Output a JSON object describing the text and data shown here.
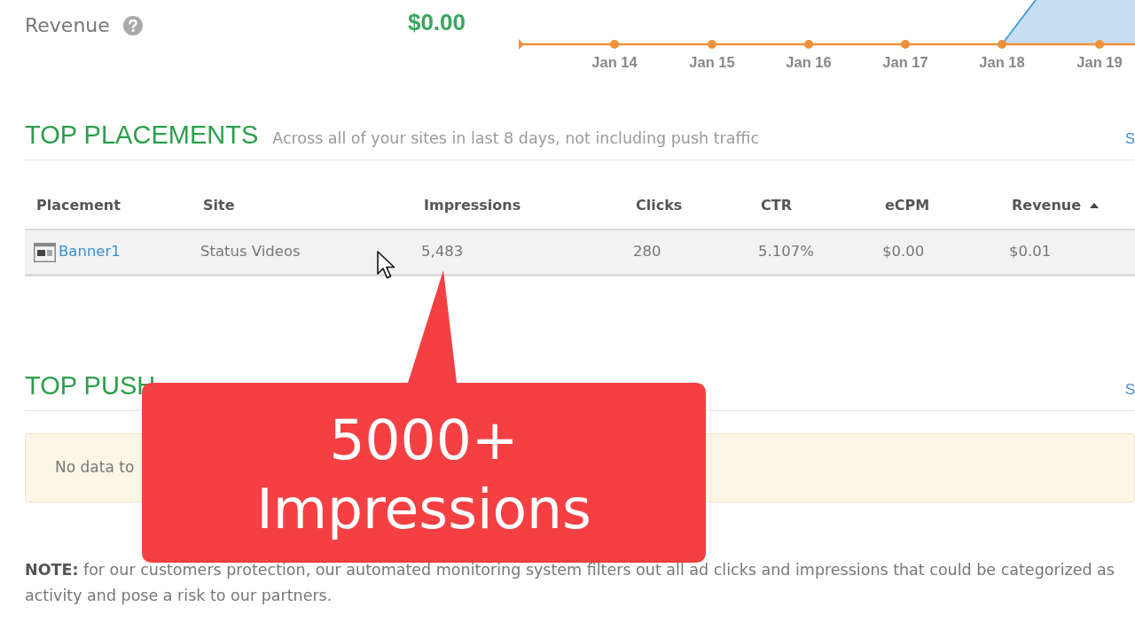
{
  "revenue": {
    "label": "Revenue",
    "value": "$0.00"
  },
  "chart": {
    "x_labels": [
      "Jan 14",
      "Jan 15",
      "Jan 16",
      "Jan 17",
      "Jan 18",
      "Jan 19"
    ]
  },
  "top_placements": {
    "title": "TOP PLACEMENTS",
    "subtitle": "Across all of your sites in last 8 days, not including push traffic",
    "link": "S",
    "columns": [
      {
        "label": "Placement",
        "kind": "placement",
        "sorted": false
      },
      {
        "label": "Site",
        "kind": "text",
        "sorted": false
      },
      {
        "label": "Impressions",
        "kind": "text",
        "sorted": false
      },
      {
        "label": "Clicks",
        "kind": "text",
        "sorted": false
      },
      {
        "label": "CTR",
        "kind": "text",
        "sorted": false
      },
      {
        "label": "eCPM",
        "kind": "text",
        "sorted": false
      },
      {
        "label": "Revenue",
        "kind": "text",
        "sorted": true
      }
    ],
    "rows": [
      {
        "cells": [
          "Banner1",
          "Status Videos",
          "5,483",
          "280",
          "5.107%",
          "$0.00",
          "$0.01"
        ],
        "highlighted": true
      }
    ]
  },
  "top_push_placements": {
    "title": "TOP PUSH",
    "link": "S",
    "message": "No data to"
  },
  "callout": {
    "lines": [
      "5000+",
      "Impressions"
    ]
  },
  "note": {
    "lines": [
      "**NOTE:**  for our customers protection, our automated monitoring system filters out all ad clicks and impressions that could be categorized as",
      "activity and pose a risk to our partners."
    ]
  }
}
